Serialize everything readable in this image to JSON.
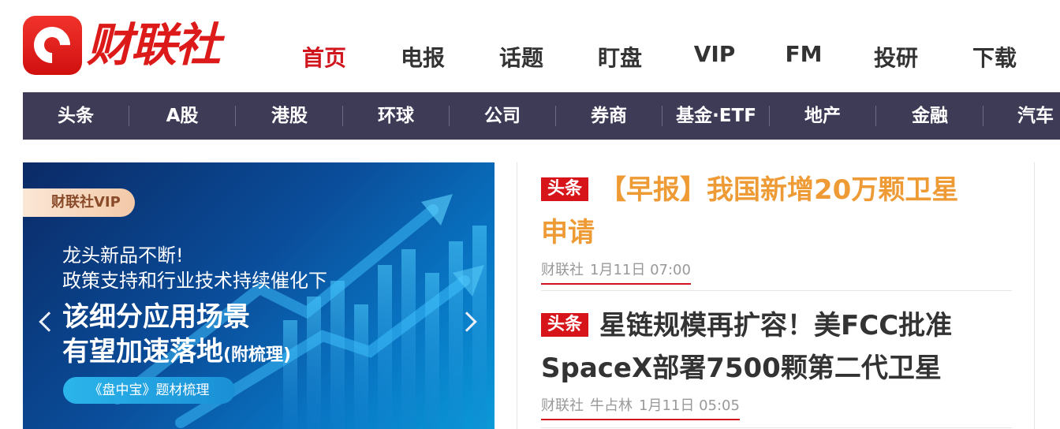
{
  "logo": {
    "text": "财联社"
  },
  "main_nav": {
    "items": [
      {
        "label": "首页",
        "active": true
      },
      {
        "label": "电报",
        "active": false
      },
      {
        "label": "话题",
        "active": false
      },
      {
        "label": "盯盘",
        "active": false
      },
      {
        "label": "VIP",
        "active": false
      },
      {
        "label": "FM",
        "active": false
      },
      {
        "label": "投研",
        "active": false
      },
      {
        "label": "下载",
        "active": false
      }
    ]
  },
  "category_bar": {
    "items": [
      "头条",
      "A股",
      "港股",
      "环球",
      "公司",
      "券商",
      "基金·ETF",
      "地产",
      "金融",
      "汽车"
    ]
  },
  "banner": {
    "vip_tag": "财联社VIP",
    "line1": "龙头新品不断!",
    "line2": "政策支持和行业技术持续催化下",
    "big1": "该细分应用场景",
    "big2": "有望加速落地",
    "big2_suffix": "(附梳理)",
    "button": "《盘中宝》题材梳理"
  },
  "news": [
    {
      "badge": "头条",
      "headline_line1": "【早报】我国新增20万颗卫星",
      "headline_line2": "申请",
      "source": "财联社",
      "author": "",
      "time": "1月11日 07:00"
    },
    {
      "badge": "头条",
      "headline_line1": "星链规模再扩容！美FCC批准",
      "headline_line2": "SpaceX部署7500颗第二代卫星",
      "source": "财联社",
      "author": "牛占林",
      "time": "1月11日 05:05"
    }
  ],
  "colors": {
    "brand_red": "#d0161c",
    "nav_bar": "#3e3b56",
    "headline_orange": "#ee9b35"
  }
}
